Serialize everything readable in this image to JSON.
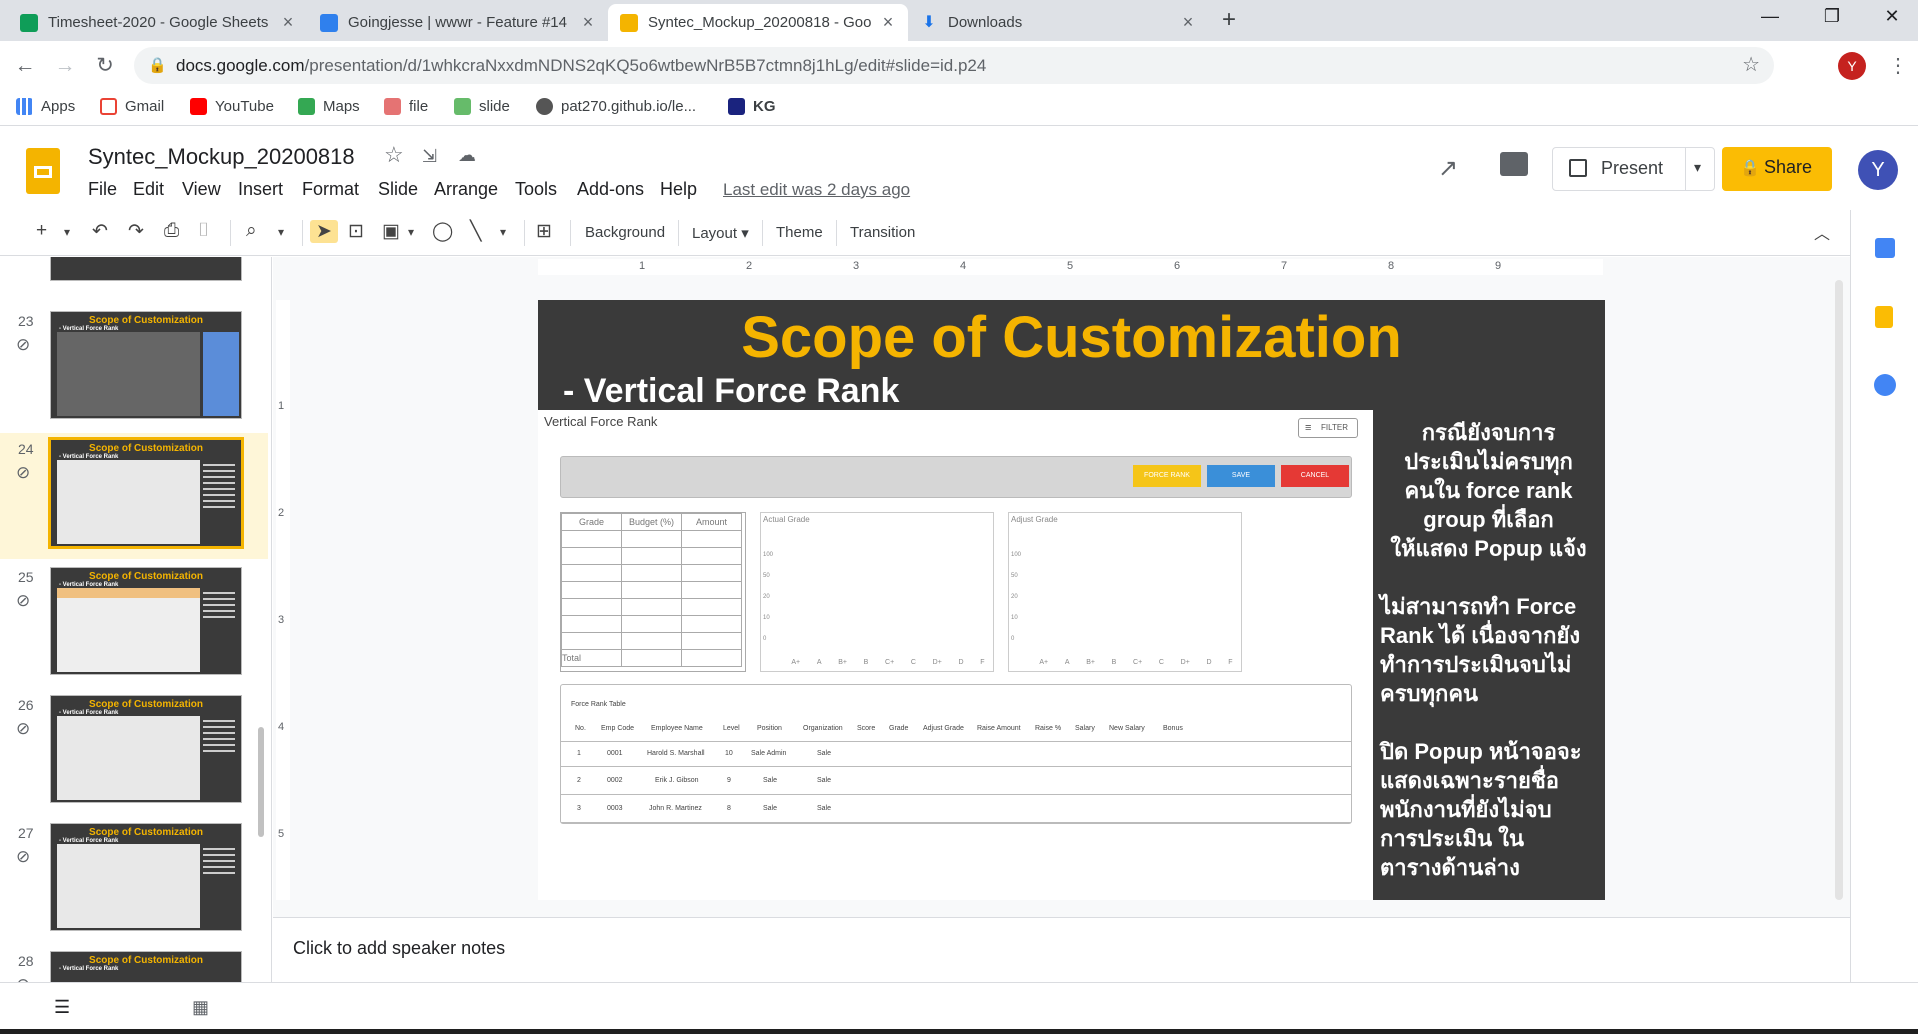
{
  "browser": {
    "tabs": [
      {
        "title": "Timesheet-2020 - Google Sheets",
        "color": "#0f9d58"
      },
      {
        "title": "Goingjesse | wwwr - Feature #14",
        "color": "#2f80ed"
      },
      {
        "title": "Syntec_Mockup_20200818 - Goo",
        "color": "#f4b400"
      },
      {
        "title": "Downloads",
        "color": "#1a73e8"
      }
    ],
    "url_host": "docs.google.com",
    "url_path": "/presentation/d/1whkcraNxxdmNDNS2qKQ5o6wtbewNrB5B7ctmn8j1hLg/edit#slide=id.p24",
    "profile_initial": "Y",
    "bookmarks": [
      "Apps",
      "Gmail",
      "YouTube",
      "Maps",
      "file",
      "slide",
      "pat270.github.io/le...",
      "KG"
    ]
  },
  "docs": {
    "title": "Syntec_Mockup_20200818",
    "menu": [
      "File",
      "Edit",
      "View",
      "Insert",
      "Format",
      "Slide",
      "Arrange",
      "Tools",
      "Add-ons",
      "Help"
    ],
    "last_edit": "Last edit was 2 days ago",
    "present_label": "Present",
    "share_label": "Share",
    "account_initial": "Y"
  },
  "toolbar": {
    "background": "Background",
    "layout": "Layout",
    "theme": "Theme",
    "transition": "Transition"
  },
  "ruler": [
    "1",
    "2",
    "3",
    "4",
    "5",
    "6",
    "7",
    "8",
    "9"
  ],
  "ruler_v": [
    "1",
    "2",
    "3",
    "4",
    "5"
  ],
  "filmstrip": [
    {
      "num": "23",
      "title": "Scope of Customization",
      "sub": "- Vertical Force Rank"
    },
    {
      "num": "24",
      "title": "Scope of Customization",
      "sub": "- Vertical Force Rank"
    },
    {
      "num": "25",
      "title": "Scope of Customization",
      "sub": "- Vertical Force Rank"
    },
    {
      "num": "26",
      "title": "Scope of Customization",
      "sub": "- Vertical Force Rank"
    },
    {
      "num": "27",
      "title": "Scope of Customization",
      "sub": "- Vertical Force Rank"
    },
    {
      "num": "28",
      "title": "Scope of Customization",
      "sub": "- Vertical Force Rank"
    }
  ],
  "slide": {
    "title": "Scope of Customization",
    "subtitle": "-  Vertical Force Rank",
    "mock": {
      "header": "Vertical Force Rank",
      "filter": "FILTER",
      "buttons": [
        {
          "label": "FORCE RANK",
          "color": "#f5c518"
        },
        {
          "label": "SAVE",
          "color": "#3a8fd9"
        },
        {
          "label": "CANCEL",
          "color": "#e53935"
        }
      ],
      "grade_headers": [
        "Grade",
        "Budget (%)",
        "Amount"
      ],
      "grade_total": "Total",
      "actual_title": "Actual Grade",
      "adjust_title": "Adjust Grade",
      "y_ticks": [
        "100",
        "50",
        "20",
        "10",
        "0"
      ],
      "x_ticks": [
        "A+",
        "A",
        "B+",
        "B",
        "C+",
        "C",
        "D+",
        "D",
        "F"
      ],
      "table_title": "Force Rank Table",
      "table_headers": [
        "No.",
        "Emp Code",
        "Employee Name",
        "Level",
        "Position",
        "Organization",
        "Score",
        "Grade",
        "Adjust Grade",
        "Raise Amount",
        "Raise %",
        "Salary",
        "New Salary",
        "Bonus"
      ],
      "rows": [
        [
          "1",
          "0001",
          "Harold S. Marshall",
          "10",
          "Sale Admin",
          "Sale"
        ],
        [
          "2",
          "0002",
          "Erik J. Gibson",
          "9",
          "Sale",
          "Sale"
        ],
        [
          "3",
          "0003",
          "John R. Martinez",
          "8",
          "Sale",
          "Sale"
        ]
      ]
    },
    "note_p1": [
      "กรณียังจบการ",
      "ประเมินไม่ครบทุก",
      "คนใน force rank",
      "group ที่เลือก",
      "ให้แสดง Popup แจ้ง"
    ],
    "note_p2": [
      "ไม่สามารถทำ Force",
      "Rank ได้ เนื่องจากยัง",
      "ทำการประเมินจบไม่",
      "ครบทุกคน"
    ],
    "note_p3": [
      "ปิด Popup หน้าจอจะ",
      "แสดงเฉพาะรายชื่อ",
      "พนักงานที่ยังไม่จบ",
      "การประเมิน ใน",
      "ตารางด้านล่าง"
    ]
  },
  "speaker_notes_placeholder": "Click to add speaker notes"
}
